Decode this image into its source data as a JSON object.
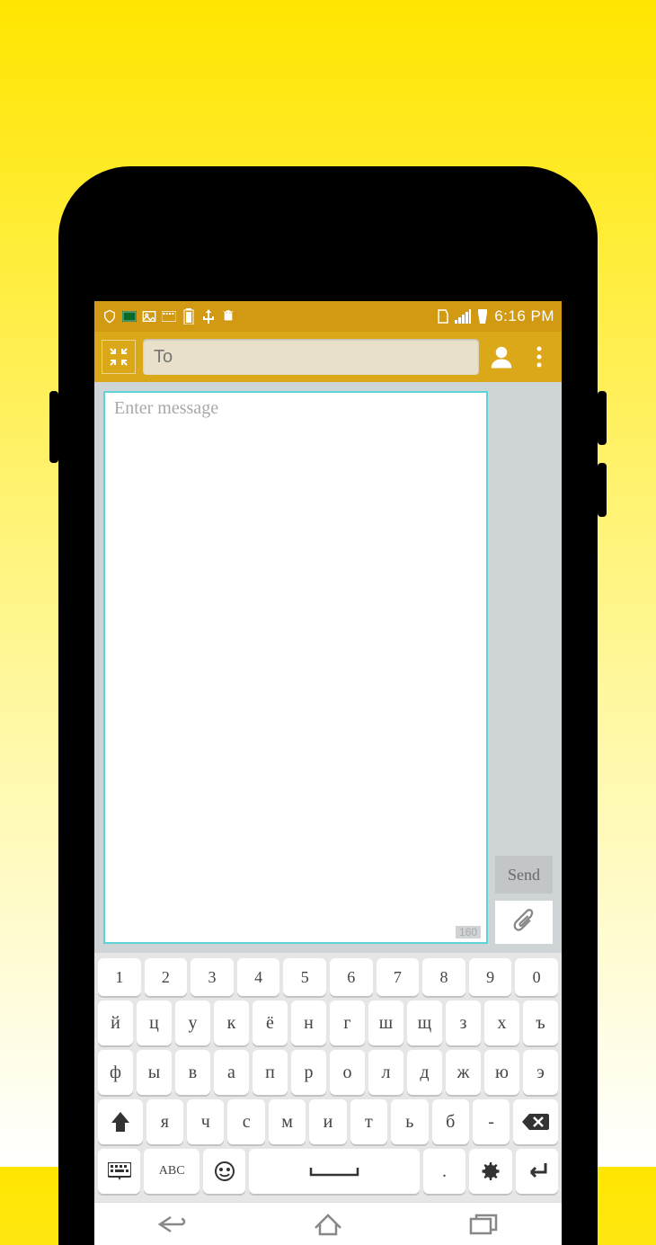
{
  "status": {
    "time": "6:16 PM"
  },
  "header": {
    "to_placeholder": "To"
  },
  "compose": {
    "msg_placeholder": "Enter message",
    "char_count": "160",
    "send_label": "Send"
  },
  "keyboard": {
    "row_num": [
      "1",
      "2",
      "3",
      "4",
      "5",
      "6",
      "7",
      "8",
      "9",
      "0"
    ],
    "row1": [
      "й",
      "ц",
      "у",
      "к",
      "ё",
      "н",
      "г",
      "ш",
      "щ",
      "з",
      "х",
      "ъ"
    ],
    "row2": [
      "ф",
      "ы",
      "в",
      "а",
      "п",
      "р",
      "о",
      "л",
      "д",
      "ж",
      "ю",
      "э"
    ],
    "row3": [
      "я",
      "ч",
      "с",
      "м",
      "и",
      "т",
      "ь",
      "б",
      "-"
    ],
    "abc_label": "ABC"
  }
}
